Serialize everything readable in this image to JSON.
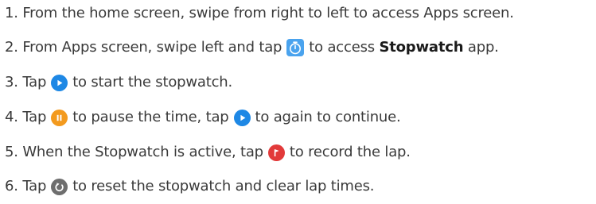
{
  "steps": [
    {
      "number": "1.",
      "text": "From the home screen, swipe from right to left to access Apps screen."
    },
    {
      "number": "2.",
      "before": "From Apps screen, swipe left and tap",
      "icon": "stopwatch-app-icon",
      "after_plain": "to access",
      "bold": "Stopwatch",
      "after_bold": "app."
    },
    {
      "number": "3.",
      "before": "Tap",
      "icon": "play-icon",
      "after": "to start the stopwatch."
    },
    {
      "number": "4.",
      "before": "Tap",
      "icon": "pause-icon",
      "middle": "to pause the time, tap",
      "icon2": "play-icon",
      "after": "to again to continue."
    },
    {
      "number": "5.",
      "before": "When the Stopwatch is active, tap",
      "icon": "flag-icon",
      "after": "to record the lap."
    },
    {
      "number": "6.",
      "before": "Tap",
      "icon": "reset-icon",
      "after": "to reset the stopwatch and clear lap times."
    }
  ],
  "colors": {
    "text": "#3a3a3a",
    "stopwatch_app_bg": "#4aa3ee",
    "play": "#1e88e5",
    "pause": "#f39a1e",
    "flag": "#e23a3a",
    "reset": "#6e6e6e"
  }
}
